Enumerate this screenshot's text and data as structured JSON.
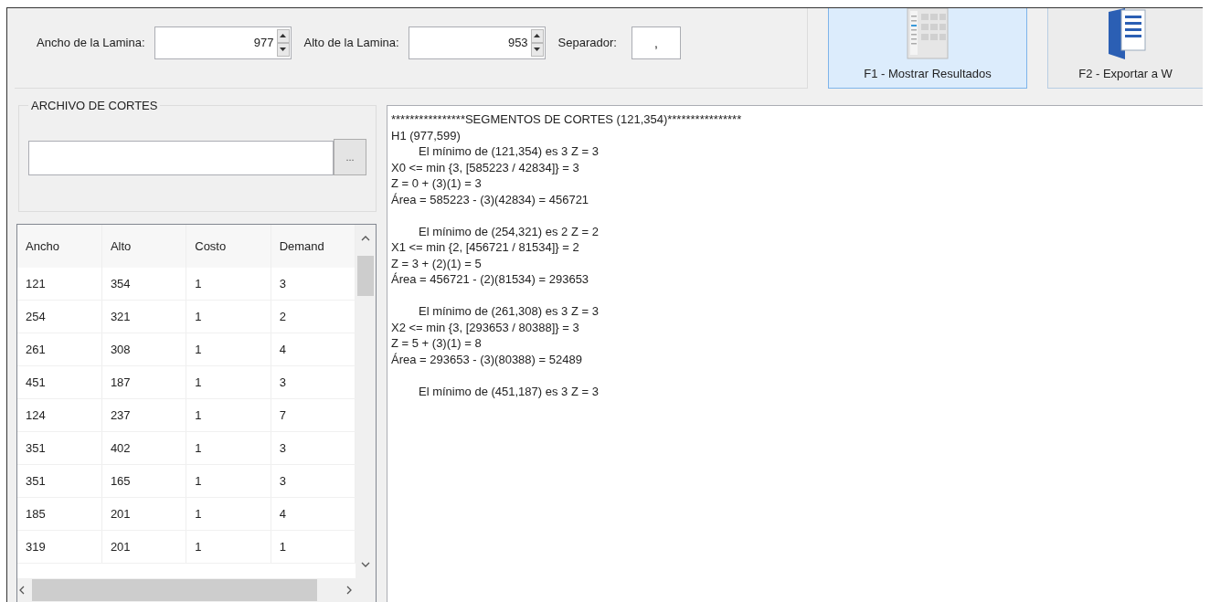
{
  "toolbar": {
    "fields": [
      {
        "label": "Ancho de la Lamina:",
        "value": "977",
        "kind": "spin"
      },
      {
        "label": "Alto de la Lamina:",
        "value": "953",
        "kind": "spin"
      },
      {
        "label": "Separador:",
        "value": ",",
        "kind": "text"
      }
    ],
    "buttons": [
      {
        "label": "F1 - Mostrar Resultados",
        "selected": true
      },
      {
        "label": "F2 - Exportar a W",
        "selected": false
      }
    ]
  },
  "file_group": {
    "title": "ARCHIVO DE CORTES",
    "browse_label": "..."
  },
  "table": {
    "columns": [
      "Ancho",
      "Alto",
      "Costo",
      "Demand"
    ],
    "rows": [
      [
        "121",
        "354",
        "1",
        "3"
      ],
      [
        "254",
        "321",
        "1",
        "2"
      ],
      [
        "261",
        "308",
        "1",
        "4"
      ],
      [
        "451",
        "187",
        "1",
        "3"
      ],
      [
        "124",
        "237",
        "1",
        "7"
      ],
      [
        "351",
        "402",
        "1",
        "3"
      ],
      [
        "351",
        "165",
        "1",
        "3"
      ],
      [
        "185",
        "201",
        "1",
        "4"
      ],
      [
        "319",
        "201",
        "1",
        "1"
      ]
    ]
  },
  "output": {
    "title": "****************SEGMENTOS DE CORTES (121,354)****************",
    "blocks": [
      [
        {
          "text": "H1 (977,599)",
          "indented": false
        },
        {
          "text": "El mínimo de (121,354) es 3 Z = 3",
          "indented": true
        },
        {
          "text": "X0 <= min {3, [585223 / 42834]} = 3",
          "indented": false
        },
        {
          "text": "Z = 0 + (3)(1) = 3",
          "indented": false
        },
        {
          "text": "Área = 585223 - (3)(42834) = 456721",
          "indented": false
        }
      ],
      [
        {
          "text": "El mínimo de (254,321) es 2 Z = 2",
          "indented": true
        },
        {
          "text": "X1 <= min {2, [456721 / 81534]} = 2",
          "indented": false
        },
        {
          "text": "Z = 3 + (2)(1) = 5",
          "indented": false
        },
        {
          "text": "Área = 456721 - (2)(81534) = 293653",
          "indented": false
        }
      ],
      [
        {
          "text": "El mínimo de (261,308) es 3 Z = 3",
          "indented": true
        },
        {
          "text": "X2 <= min {3, [293653 / 80388]} = 3",
          "indented": false
        },
        {
          "text": "Z = 5 + (3)(1) = 8",
          "indented": false
        },
        {
          "text": "Área = 293653 - (3)(80388) = 52489",
          "indented": false
        }
      ],
      [
        {
          "text": "El mínimo de (451,187) es 3 Z = 3",
          "indented": true
        }
      ]
    ]
  }
}
